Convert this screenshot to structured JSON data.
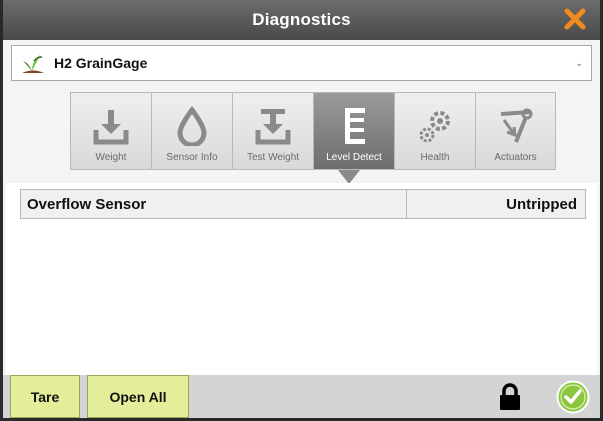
{
  "window": {
    "title": "Diagnostics"
  },
  "device_selector": {
    "selected": "H2 GrainGage"
  },
  "tabs": [
    {
      "label": "Weight",
      "icon": "download-icon"
    },
    {
      "label": "Sensor Info",
      "icon": "droplet-icon"
    },
    {
      "label": "Test Weight",
      "icon": "test-weight-icon"
    },
    {
      "label": "Level Detect",
      "icon": "level-detect-icon",
      "active": true
    },
    {
      "label": "Health",
      "icon": "gears-icon"
    },
    {
      "label": "Actuators",
      "icon": "actuator-icon"
    }
  ],
  "table": {
    "rows": [
      {
        "name": "Overflow Sensor",
        "value": "Untripped"
      }
    ]
  },
  "bottom_bar": {
    "tare_label": "Tare",
    "open_all_label": "Open All"
  },
  "colors": {
    "accent_close": "#f28a1e",
    "button_bg": "#e4ee9a",
    "ok_green": "#8cc63f"
  }
}
